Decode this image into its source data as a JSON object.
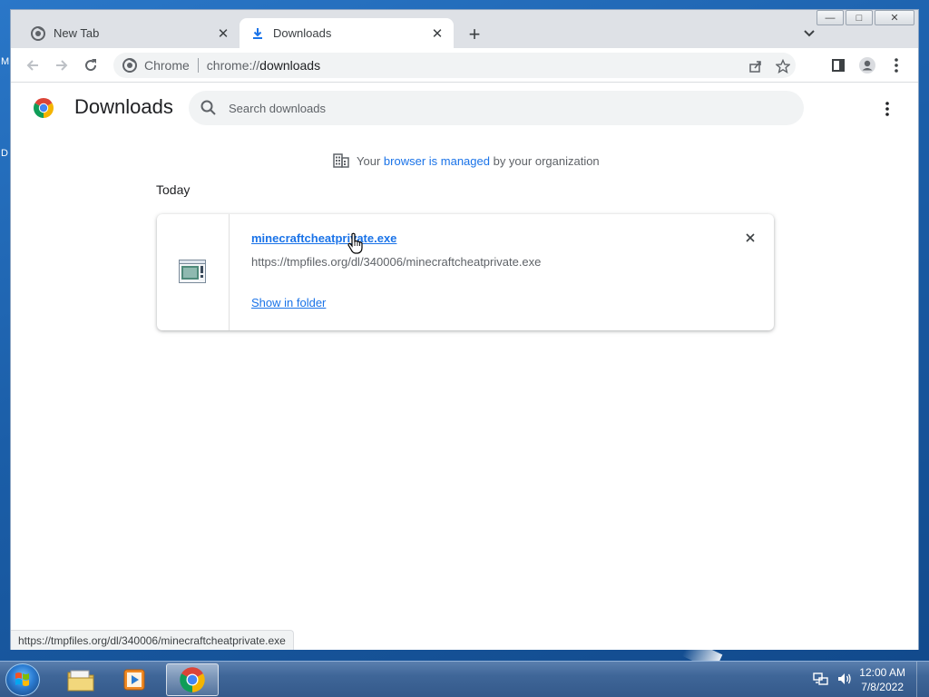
{
  "window": {
    "minimize_label": "—",
    "maximize_label": "□",
    "close_label": "✕"
  },
  "tabs": [
    {
      "title": "New Tab",
      "icon": "chrome-icon",
      "active": false
    },
    {
      "title": "Downloads",
      "icon": "download-icon",
      "active": true
    }
  ],
  "toolbar": {
    "site_label": "Chrome",
    "url_scheme": "chrome://",
    "url_host": "downloads"
  },
  "page": {
    "title": "Downloads",
    "search_placeholder": "Search downloads",
    "managed_prefix": "Your",
    "managed_link": "browser is managed",
    "managed_suffix": "by your organization",
    "section_label": "Today"
  },
  "download": {
    "file_name": "minecraftcheatprivate.exe",
    "url": "https://tmpfiles.org/dl/340006/minecraftcheatprivate.exe",
    "action_label": "Show in folder"
  },
  "status_bar": {
    "text": "https://tmpfiles.org/dl/340006/minecraftcheatprivate.exe"
  },
  "desktop": {
    "edge_letters": [
      "M",
      "D"
    ]
  },
  "taskbar": {
    "time": "12:00 AM",
    "date": "7/8/2022"
  },
  "colors": {
    "accent": "#1a73e8",
    "tab_strip": "#dee1e6",
    "taskbar": "#3f6698"
  }
}
